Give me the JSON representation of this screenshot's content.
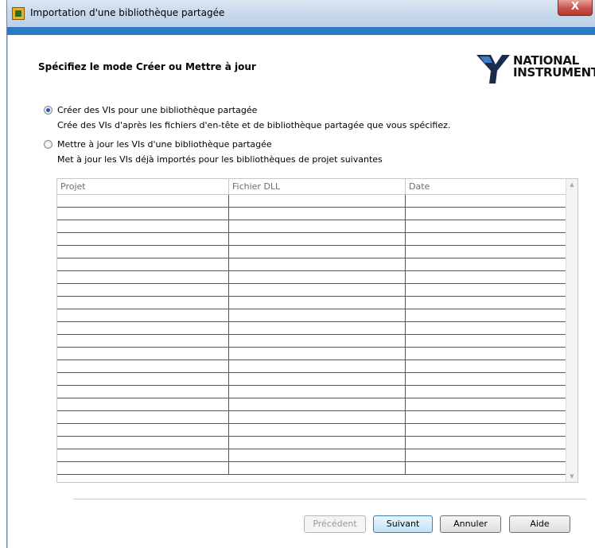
{
  "window": {
    "title": "Importation d'une bibliothèque partagée",
    "close_label": "X"
  },
  "page": {
    "heading": "Spécifiez le mode Créer ou Mettre à jour"
  },
  "logo": {
    "line1": "NATIONAL",
    "line2": "INSTRUMENTS",
    "trademark": "™"
  },
  "options": [
    {
      "label": "Créer des VIs pour une bibliothèque partagée",
      "description": "Crée des VIs d'après les fichiers d'en-tête et de bibliothèque partagée que vous spécifiez.",
      "selected": true
    },
    {
      "label": "Mettre à jour les VIs d'une bibliothèque partagée",
      "description": "Met à jour les VIs déjà importés pour les bibliothèques de projet suivantes",
      "selected": false
    }
  ],
  "table": {
    "columns": [
      "Projet",
      "Fichier DLL",
      "Date"
    ],
    "row_count": 22,
    "rows": []
  },
  "buttons": {
    "previous": "Précédent",
    "next": "Suivant",
    "cancel": "Annuler",
    "help": "Aide"
  },
  "colors": {
    "accent_band": "#2a7ac4",
    "radio_dot": "#1d5fae",
    "close_button": "#c75050"
  }
}
